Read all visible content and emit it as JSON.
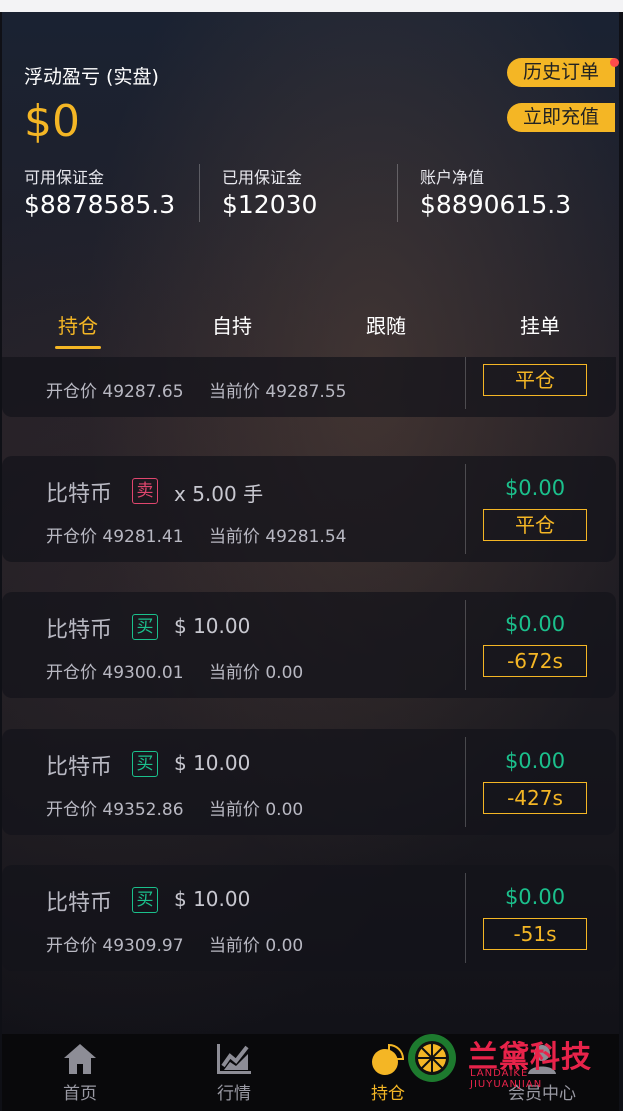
{
  "header": {
    "float_title": "浮动盈亏 (实盘)",
    "float_value": "$0",
    "history_button": "历史订单",
    "recharge_button": "立即充值"
  },
  "stats": [
    {
      "label": "可用保证金",
      "value": "$8878585.3"
    },
    {
      "label": "已用保证金",
      "value": "$12030"
    },
    {
      "label": "账户净值",
      "value": "$8890615.3"
    }
  ],
  "tabs": [
    "持仓",
    "自持",
    "跟随",
    "挂单"
  ],
  "positions": [
    {
      "name": "",
      "side": "",
      "qty": "",
      "open_label": "开仓价",
      "open_price": "49287.65",
      "cur_label": "当前价",
      "cur_price": "49287.55",
      "pnl": "",
      "action": "平仓"
    },
    {
      "name": "比特币",
      "side": "卖",
      "qty": "x 5.00 手",
      "open_label": "开仓价",
      "open_price": "49281.41",
      "cur_label": "当前价",
      "cur_price": "49281.54",
      "pnl": "$0.00",
      "action": "平仓"
    },
    {
      "name": "比特币",
      "side": "买",
      "qty": "$ 10.00",
      "open_label": "开仓价",
      "open_price": "49300.01",
      "cur_label": "当前价",
      "cur_price": "0.00",
      "pnl": "$0.00",
      "action": "-672s"
    },
    {
      "name": "比特币",
      "side": "买",
      "qty": "$ 10.00",
      "open_label": "开仓价",
      "open_price": "49352.86",
      "cur_label": "当前价",
      "cur_price": "0.00",
      "pnl": "$0.00",
      "action": "-427s"
    },
    {
      "name": "比特币",
      "side": "买",
      "qty": "$ 10.00",
      "open_label": "开仓价",
      "open_price": "49309.97",
      "cur_label": "当前价",
      "cur_price": "0.00",
      "pnl": "$0.00",
      "action": "-51s"
    }
  ],
  "bottom_nav": [
    {
      "label": "首页",
      "icon": "home-icon"
    },
    {
      "label": "行情",
      "icon": "chart-icon"
    },
    {
      "label": "持仓",
      "icon": "pie-icon"
    },
    {
      "label": "会员中心",
      "icon": "user-icon"
    }
  ],
  "watermark": {
    "cn": "兰黛科技",
    "en": "LANDAIKE JIUYUANJIAN"
  },
  "colors": {
    "accent": "#f4b625",
    "buy": "#1bc08c",
    "sell": "#e0466e",
    "alert_dot": "#ff4b4b"
  }
}
